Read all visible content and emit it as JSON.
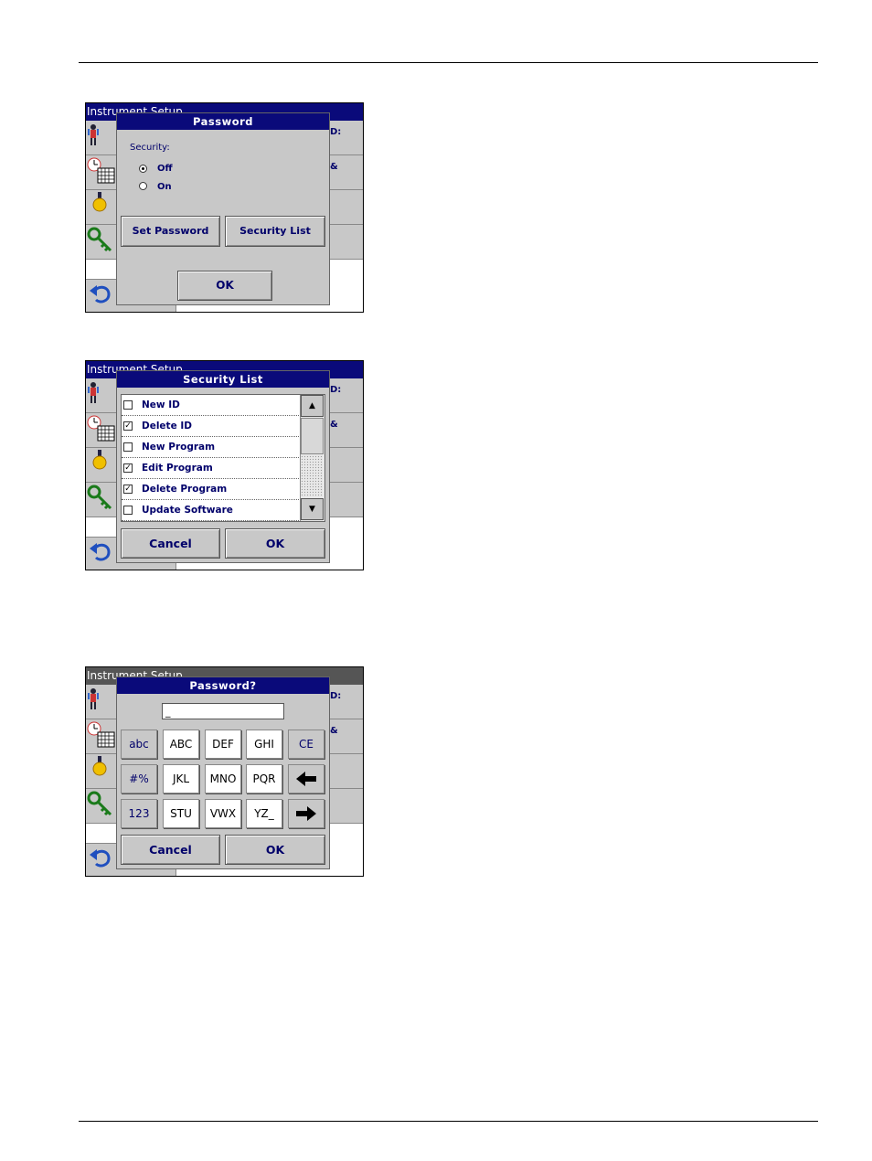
{
  "screen1": {
    "app_title": "Instrument Setup",
    "bg_items": [
      "D:",
      "&"
    ],
    "dialog": {
      "title": "Password",
      "security_label": "Security:",
      "options": [
        {
          "label": "Off",
          "selected": true
        },
        {
          "label": "On",
          "selected": false
        }
      ],
      "set_password_label": "Set Password",
      "security_list_label": "Security List",
      "ok_label": "OK"
    }
  },
  "screen2": {
    "app_title": "Instrument Setup",
    "bg_items": [
      "D:",
      "&"
    ],
    "dialog": {
      "title": "Security List",
      "items": [
        {
          "label": "New ID",
          "checked": false
        },
        {
          "label": "Delete ID",
          "checked": true
        },
        {
          "label": "New Program",
          "checked": false
        },
        {
          "label": "Edit Program",
          "checked": true
        },
        {
          "label": "Delete Program",
          "checked": true
        },
        {
          "label": "Update Software",
          "checked": false
        }
      ],
      "cancel_label": "Cancel",
      "ok_label": "OK"
    }
  },
  "screen3": {
    "app_title": "Instrument Setup",
    "bg_items": [
      "D:",
      "&"
    ],
    "dialog": {
      "title": "Password?",
      "field_value": "_",
      "keys": [
        [
          "abc",
          "ABC",
          "DEF",
          "GHI",
          "CE"
        ],
        [
          "#%",
          "JKL",
          "MNO",
          "PQR",
          "backspace"
        ],
        [
          "123",
          "STU",
          "VWX",
          "YZ_",
          "right"
        ]
      ],
      "cancel_label": "Cancel",
      "ok_label": "OK"
    }
  },
  "icons": [
    "person-icon",
    "clock-calendar-icon",
    "lamp-icon",
    "key-icon",
    "back-arrow-icon"
  ],
  "colors": {
    "title_bar": "#0a0a7a",
    "text_blue": "#00006a",
    "panel_grey": "#c8c8c8"
  }
}
